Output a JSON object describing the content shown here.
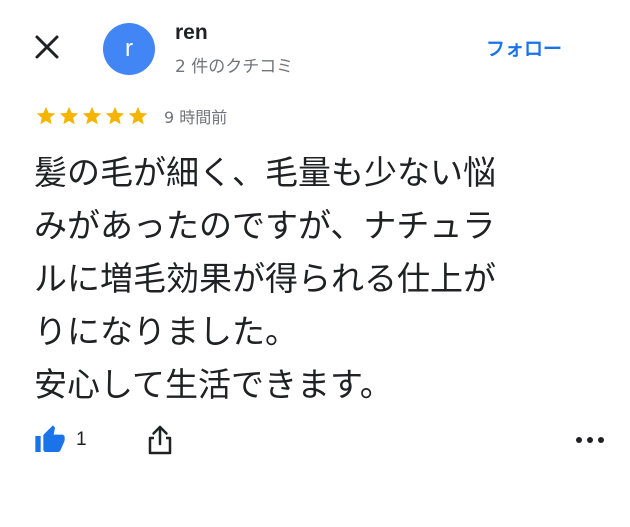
{
  "header": {
    "close_icon": "close-icon",
    "avatar_letter": "r",
    "avatar_color": "#4285f4",
    "user_name": "ren",
    "review_count": "2 件のクチコミ",
    "follow_label": "フォロー"
  },
  "review": {
    "rating": 5,
    "rating_max": 5,
    "star_color": "#f4b400",
    "time_ago": "9 時間前",
    "lines": [
      "髪の毛が細く、毛量も少ない悩",
      "みがあったのですが、ナチュラ",
      "ルに増毛効果が得られる仕上が",
      "りになりました。",
      "安心して生活できます。"
    ]
  },
  "actions": {
    "like_icon": "thumbs-up-icon",
    "like_count": "1",
    "share_icon": "share-icon",
    "more_icon": "more-options-icon",
    "accent_color": "#1a73e8"
  }
}
